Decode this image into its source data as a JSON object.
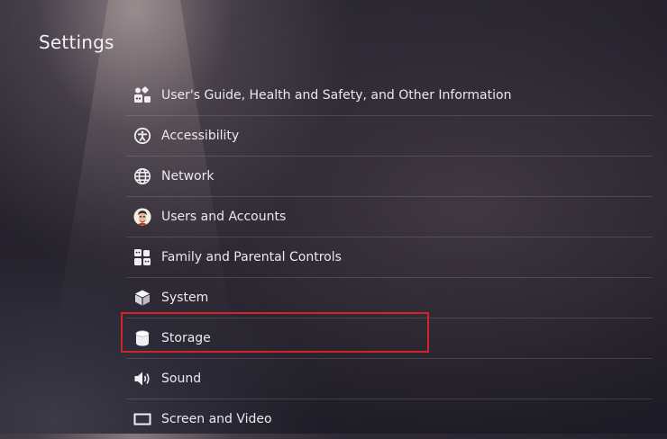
{
  "header": {
    "title": "Settings"
  },
  "menu": {
    "items": [
      {
        "label": "User's Guide, Health and Safety, and Other Information",
        "icon": "guide-icon"
      },
      {
        "label": "Accessibility",
        "icon": "accessibility-icon"
      },
      {
        "label": "Network",
        "icon": "globe-icon"
      },
      {
        "label": "Users and Accounts",
        "icon": "avatar-icon"
      },
      {
        "label": "Family and Parental Controls",
        "icon": "family-icon"
      },
      {
        "label": "System",
        "icon": "cube-icon"
      },
      {
        "label": "Storage",
        "icon": "storage-icon"
      },
      {
        "label": "Sound",
        "icon": "speaker-icon"
      },
      {
        "label": "Screen and Video",
        "icon": "screen-icon"
      }
    ],
    "selected": "Storage"
  },
  "colors": {
    "highlight": "#d2222a",
    "background": "#24212c",
    "text": "#ebe9ee"
  }
}
